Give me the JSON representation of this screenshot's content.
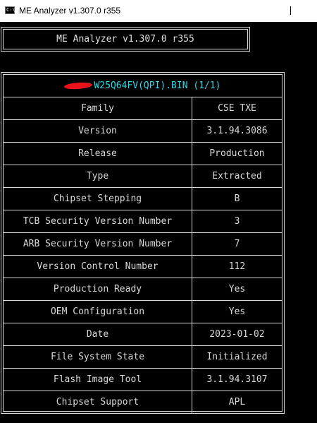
{
  "window": {
    "title": "ME Analyzer v1.307.0 r355",
    "icon_label": "C:\\"
  },
  "console": {
    "banner": "ME Analyzer v1.307.0 r355",
    "file": {
      "name": "W25Q64FV(QPI).BIN (1/1)",
      "redacted": true
    },
    "rows": [
      {
        "key": "Family",
        "value": "CSE TXE"
      },
      {
        "key": "Version",
        "value": "3.1.94.3086"
      },
      {
        "key": "Release",
        "value": "Production"
      },
      {
        "key": "Type",
        "value": "Extracted"
      },
      {
        "key": "Chipset Stepping",
        "value": "B"
      },
      {
        "key": "TCB Security Version Number",
        "value": "3"
      },
      {
        "key": "ARB Security Version Number",
        "value": "7"
      },
      {
        "key": "Version Control Number",
        "value": "112"
      },
      {
        "key": "Production Ready",
        "value": "Yes"
      },
      {
        "key": "OEM Configuration",
        "value": "Yes"
      },
      {
        "key": "Date",
        "value": "2023-01-02"
      },
      {
        "key": "File System State",
        "value": "Initialized"
      },
      {
        "key": "Flash Image Tool",
        "value": "3.1.94.3107"
      },
      {
        "key": "Chipset Support",
        "value": "APL"
      }
    ]
  },
  "colors": {
    "background": "#000000",
    "text": "#d8d8d8",
    "filename": "#32d7e6",
    "redaction": "#e8121b"
  }
}
